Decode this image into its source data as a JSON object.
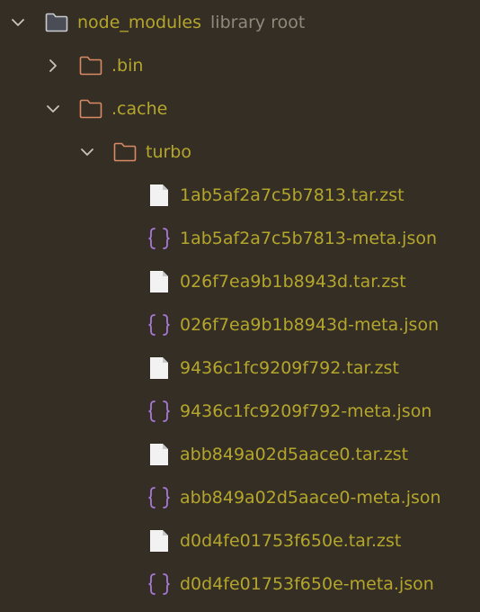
{
  "tree": {
    "root": {
      "label": "node_modules",
      "hint": "library root",
      "icon": "folder-icon",
      "expanded": true
    },
    "items": [
      {
        "label": ".bin",
        "icon": "folder-icon",
        "expanded": false
      },
      {
        "label": ".cache",
        "icon": "folder-icon",
        "expanded": true
      },
      {
        "label": "turbo",
        "icon": "folder-icon",
        "expanded": true
      }
    ],
    "files": [
      {
        "label": "1ab5af2a7c5b7813.tar.zst",
        "icon": "file-icon"
      },
      {
        "label": "1ab5af2a7c5b7813-meta.json",
        "icon": "json-icon"
      },
      {
        "label": "026f7ea9b1b8943d.tar.zst",
        "icon": "file-icon"
      },
      {
        "label": "026f7ea9b1b8943d-meta.json",
        "icon": "json-icon"
      },
      {
        "label": "9436c1fc9209f792.tar.zst",
        "icon": "file-icon"
      },
      {
        "label": "9436c1fc9209f792-meta.json",
        "icon": "json-icon"
      },
      {
        "label": "abb849a02d5aace0.tar.zst",
        "icon": "file-icon"
      },
      {
        "label": "abb849a02d5aace0-meta.json",
        "icon": "json-icon"
      },
      {
        "label": "d0d4fe01753f650e.tar.zst",
        "icon": "file-icon"
      },
      {
        "label": "d0d4fe01753f650e-meta.json",
        "icon": "json-icon"
      }
    ]
  },
  "colors": {
    "background": "#352e24",
    "label": "#b4a62c",
    "hint": "#8f8a7c",
    "folder_root": "#c9cbd1",
    "folder": "#d88a64",
    "json": "#a679d8",
    "file": "#f2f2f2",
    "chevron": "#c9c5bb"
  }
}
